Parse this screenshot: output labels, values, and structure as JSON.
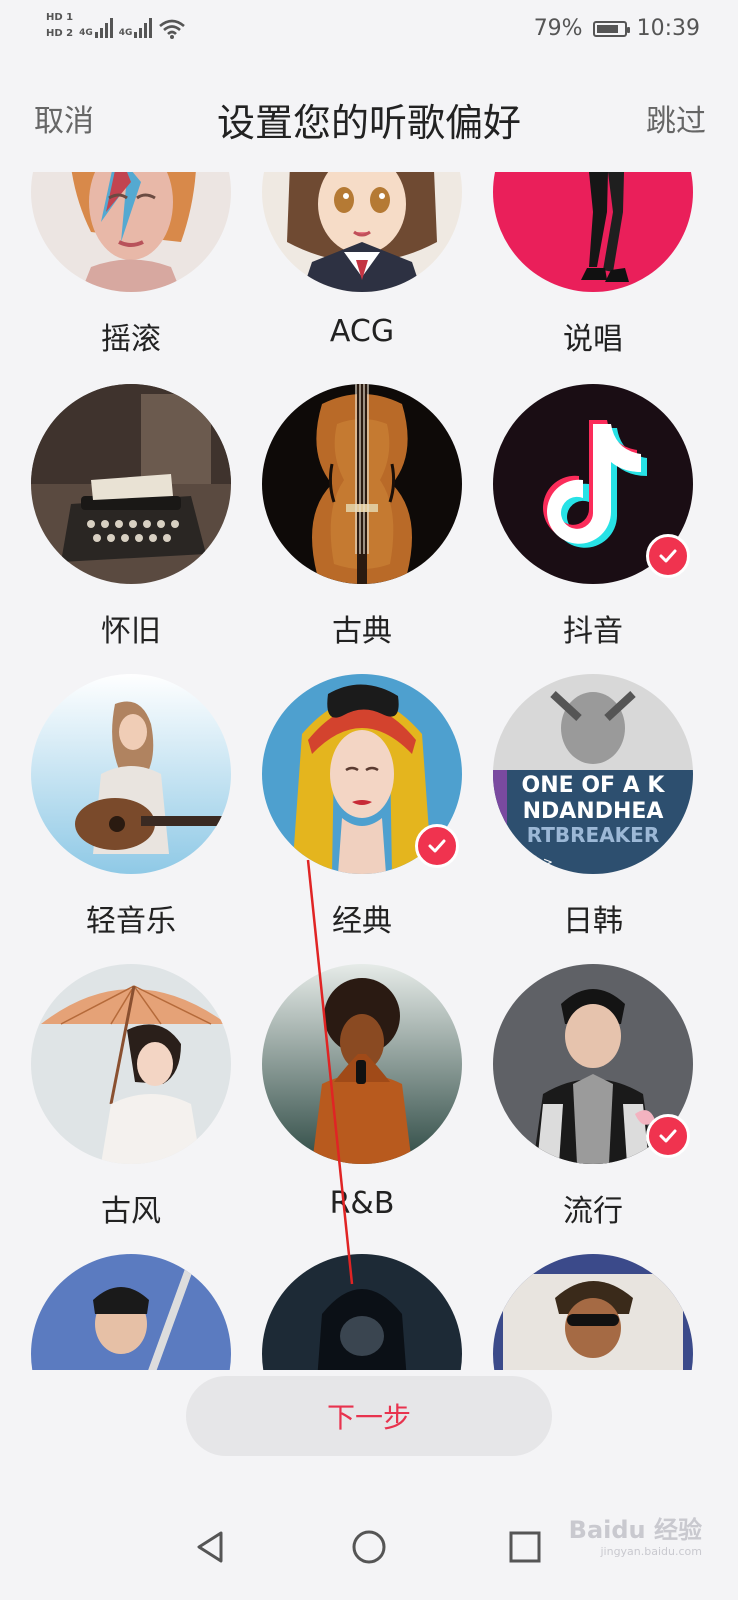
{
  "status_bar": {
    "hd1": "HD 1",
    "hd2": "HD 2",
    "net1": "4G",
    "net2": "4G",
    "battery_percent": "79%",
    "battery_level": 0.79,
    "time": "10:39"
  },
  "header": {
    "cancel_label": "取消",
    "title": "设置您的听歌偏好",
    "skip_label": "跳过"
  },
  "genres": [
    {
      "label": "摇滚",
      "selected": false
    },
    {
      "label": "ACG",
      "selected": false
    },
    {
      "label": "说唱",
      "selected": false
    },
    {
      "label": "怀旧",
      "selected": false
    },
    {
      "label": "古典",
      "selected": false
    },
    {
      "label": "抖音",
      "selected": true
    },
    {
      "label": "轻音乐",
      "selected": false
    },
    {
      "label": "经典",
      "selected": true
    },
    {
      "label": "日韩",
      "selected": false
    },
    {
      "label": "古风",
      "selected": false
    },
    {
      "label": "R&B",
      "selected": false
    },
    {
      "label": "流行",
      "selected": true
    }
  ],
  "album_text": {
    "line1": "ONE OF A K",
    "line2": "NDANDHEA",
    "line3": "RTBREAKER",
    "sub": "五首 >"
  },
  "next_button": {
    "label": "下一步"
  },
  "watermark": {
    "brand": "Baidu 经验",
    "url": "jingyan.baidu.com"
  },
  "colors": {
    "accent": "#e8334e",
    "check": "#f0334f",
    "background": "#f4f4f6"
  },
  "icons": {
    "back": "triangle-back-icon",
    "home": "circle-home-icon",
    "recents": "square-recents-icon"
  }
}
